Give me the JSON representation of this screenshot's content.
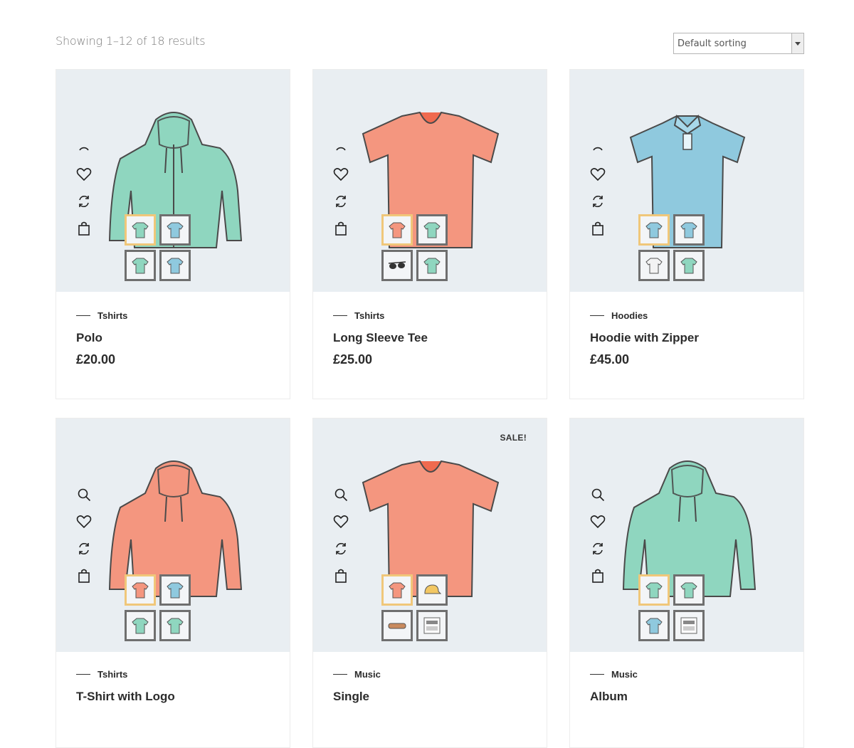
{
  "toolbar": {
    "result_count": "Showing 1–12 of 18 results",
    "sort_value": "Default sorting"
  },
  "colors": {
    "media_bg": "#e9eef2",
    "active_swatch": "#f0c77a",
    "mint": "#8fd6bf",
    "coral": "#f4967f",
    "sky": "#8fc9de"
  },
  "products": [
    {
      "category": "Tshirts",
      "title": "Polo",
      "price": "£20.00",
      "image": "mint-zip-hoodie",
      "swatches": [
        "mint-hoodie",
        "blue-polo",
        "mint-sweater",
        "blue-polo"
      ]
    },
    {
      "category": "Tshirts",
      "title": "Long Sleeve Tee",
      "price": "£25.00",
      "image": "coral-vneck-tee",
      "swatches": [
        "coral-tee",
        "mint-tee",
        "sunglasses",
        "mint-sweater"
      ]
    },
    {
      "category": "Hoodies",
      "title": "Hoodie with Zipper",
      "price": "£45.00",
      "image": "blue-polo",
      "swatches": [
        "blue-polo",
        "blue-hoodie",
        "white-tee",
        "mint-hoodie"
      ]
    },
    {
      "category": "Tshirts",
      "title": "T-Shirt with Logo",
      "price": "",
      "image": "coral-hoodie",
      "swatches": [
        "coral-hoodie",
        "blue-hoodie",
        "mint-hoodie",
        "mint-tee"
      ]
    },
    {
      "category": "Music",
      "title": "Single",
      "price": "",
      "sale": "SALE!",
      "image": "coral-vneck-tee",
      "swatches": [
        "coral-tee",
        "cap",
        "belt",
        "album-art"
      ]
    },
    {
      "category": "Music",
      "title": "Album",
      "price": "",
      "image": "mint-hoodie",
      "swatches": [
        "mint-hoodie",
        "mint-sweater",
        "blue-polo",
        "album-art"
      ]
    }
  ]
}
